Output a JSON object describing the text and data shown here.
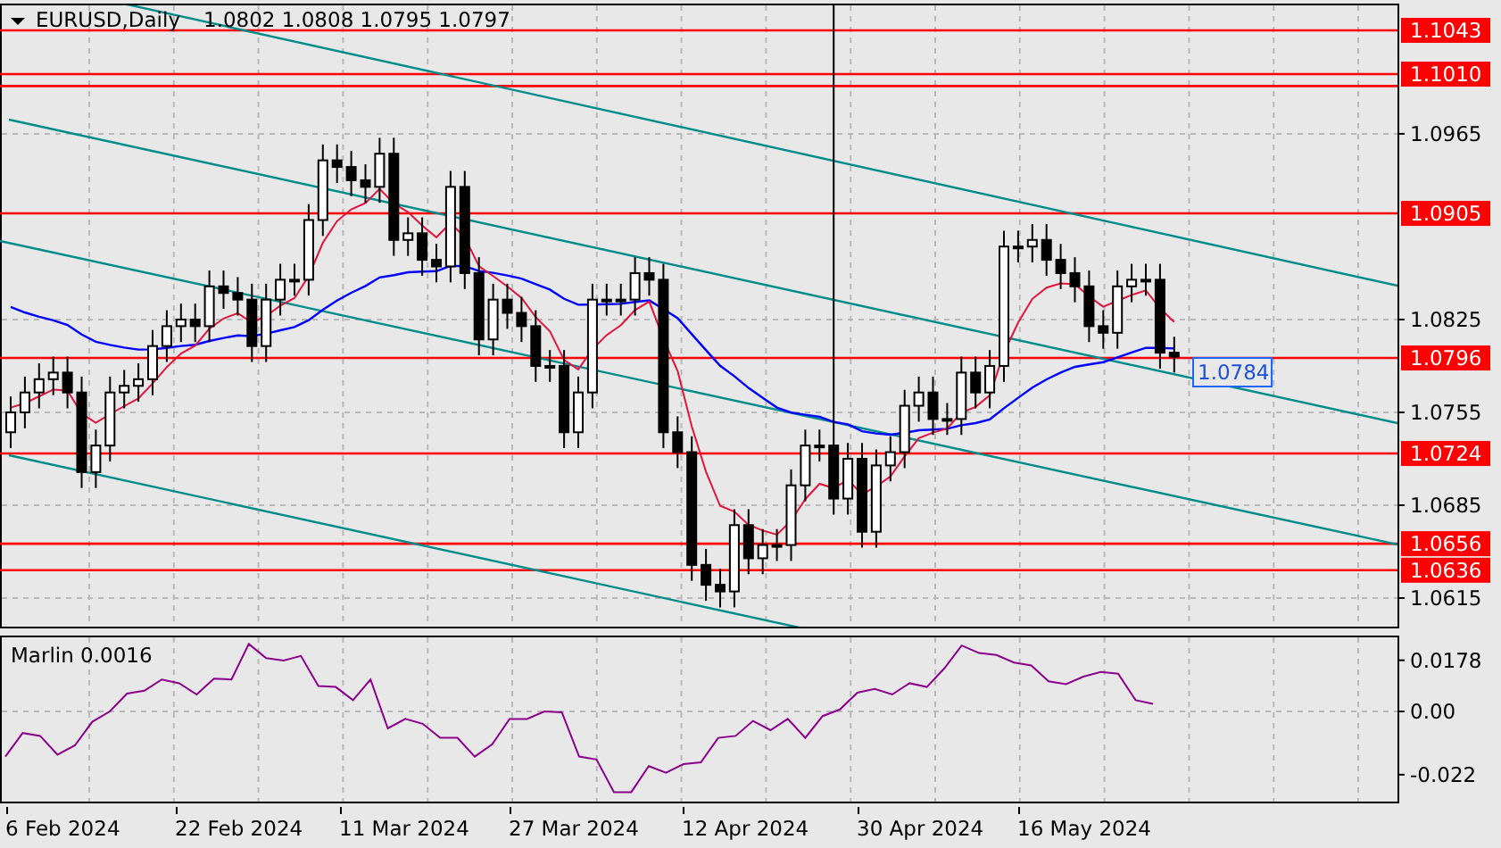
{
  "header": {
    "symbol": "EURUSD,Daily",
    "ohlc": "1.0802 1.0808 1.0795 1.0797"
  },
  "price_axis": {
    "ticks": [
      "1.0965",
      "1.0825",
      "1.0755",
      "1.0685",
      "1.0615"
    ]
  },
  "levels": [
    {
      "label": "1.1043"
    },
    {
      "label": "1.1010"
    },
    {
      "label": "1.0905"
    },
    {
      "label": "1.0796"
    },
    {
      "label": "1.0724"
    },
    {
      "label": "1.0656"
    },
    {
      "label": "1.0636"
    }
  ],
  "moving_average_label": "1.0784",
  "indicator": {
    "value": "0.0016",
    "chart_data": {
      "type": "line",
      "grid": true,
      "ylim": [
        -0.032,
        0.027
      ],
      "yticks": [
        {
          "value": 0.0178,
          "label": "0.0178"
        },
        {
          "value": 0,
          "label": "0.00"
        },
        {
          "value": -0.022,
          "label": "-0.022"
        }
      ],
      "series": [
        {
          "name": "Marlin",
          "color": "#8b008b",
          "values": [
            -0.0157,
            -0.0075,
            -0.0085,
            -0.015,
            -0.0118,
            -0.0036,
            0,
            0.0062,
            0.0072,
            0.0111,
            0.0098,
            0.0059,
            0.0114,
            0.0111,
            0.0235,
            0.0186,
            0.0177,
            0.0193,
            0.0088,
            0.0085,
            0.0039,
            0.0111,
            -0.0059,
            -0.0026,
            -0.0043,
            -0.0092,
            -0.0092,
            -0.0157,
            -0.0114,
            -0.0026,
            -0.0026,
            0,
            -0.0003,
            -0.0157,
            -0.0167,
            -0.0281,
            -0.0281,
            -0.019,
            -0.0213,
            -0.0183,
            -0.0177,
            -0.0092,
            -0.0085,
            -0.0033,
            -0.0065,
            -0.0026,
            -0.0092,
            -0.0016,
            0.0007,
            0.0065,
            0.0078,
            0.0059,
            0.0098,
            0.0085,
            0.015,
            0.0229,
            0.0203,
            0.0196,
            0.017,
            0.016,
            0.0105,
            0.0095,
            0.0121,
            0.0137,
            0.0131,
            0.0039,
            0.0026
          ]
        }
      ]
    }
  },
  "date_axis": [
    "6 Feb 2024",
    "22 Feb 2024",
    "11 Mar 2024",
    "27 Mar 2024",
    "12 Apr 2024",
    "30 Apr 2024",
    "16 May 2024"
  ]
}
